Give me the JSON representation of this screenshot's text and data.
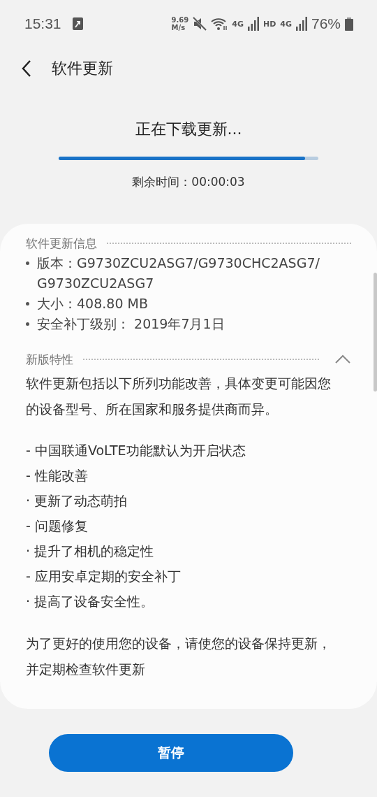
{
  "status_bar": {
    "time": "15:31",
    "speed_value": "9.69",
    "speed_unit": "M/s",
    "network_1": "4G",
    "hd": "HD",
    "network_2": "4G",
    "battery": "76%"
  },
  "header": {
    "title": "软件更新"
  },
  "download": {
    "status": "正在下载更新...",
    "level": 0.95,
    "remaining": "剩余时间：00:00:03"
  },
  "info": {
    "title": "软件更新信息",
    "items": [
      "版本：G9730ZCU2ASG7/G9730CHC2ASG7/ G9730ZCU2ASG7",
      "大小：408.80 MB",
      "安全补丁级别： 2019年7月1日"
    ]
  },
  "features": {
    "title": "新版特性",
    "expanded": true,
    "intro": "软件更新包括以下所列功能改善，具体变更可能因您的设备型号、所在国家和服务提供商而异。",
    "items": [
      "- 中国联通VoLTE功能默认为开启状态",
      "- 性能改善",
      "· 更新了动态萌拍",
      "- 问题修复",
      "· 提升了相机的稳定性",
      "- 应用安卓定期的安全补丁",
      "· 提高了设备安全性。"
    ],
    "outro": "为了更好的使用您的设备，请使您的设备保持更新，并定期检查软件更新"
  },
  "button": {
    "label": "暂停"
  }
}
